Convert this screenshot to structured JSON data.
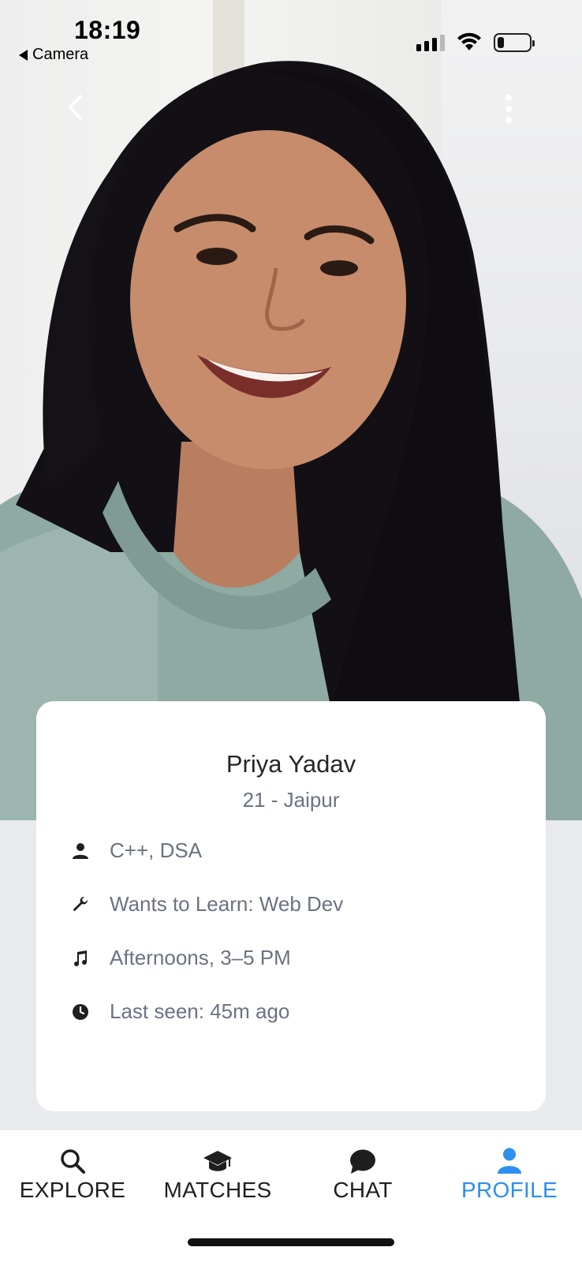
{
  "status_bar": {
    "time": "18:19",
    "back_app": "Camera",
    "battery_level": 0.2
  },
  "profile": {
    "name": "Priya Yadav",
    "subtitle": "21 - Jaipur",
    "details": [
      {
        "icon": "person-icon",
        "text": "C++, DSA"
      },
      {
        "icon": "wrench-icon",
        "text": "Wants to Learn: Web Dev"
      },
      {
        "icon": "music-note-icon",
        "text": "Afternoons, 3–5 PM"
      },
      {
        "icon": "clock-icon",
        "text": "Last seen: 45m ago"
      }
    ]
  },
  "tabs": [
    {
      "label": "EXPLORE",
      "icon": "search-icon",
      "active": false
    },
    {
      "label": "MATCHES",
      "icon": "graduation-cap-icon",
      "active": false
    },
    {
      "label": "CHAT",
      "icon": "chat-bubble-icon",
      "active": false
    },
    {
      "label": "PROFILE",
      "icon": "person-icon",
      "active": true
    }
  ],
  "colors": {
    "accent": "#2d8ff0",
    "secondary_text": "#6b7280",
    "background": "#e9eaee"
  }
}
